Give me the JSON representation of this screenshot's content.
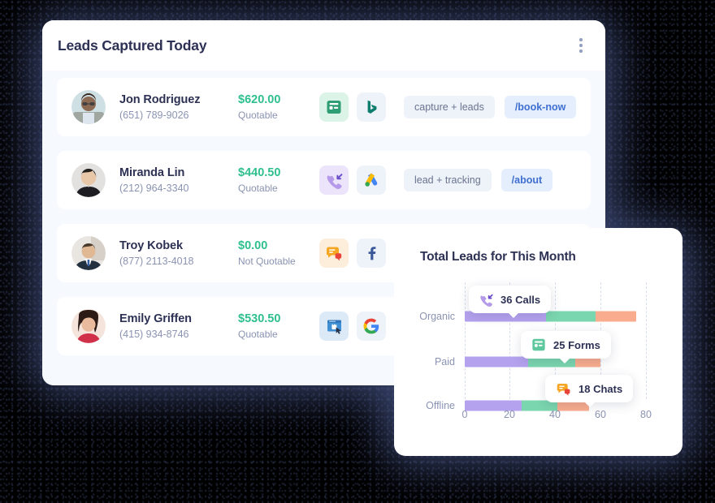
{
  "header": {
    "title": "Leads Captured Today",
    "menu_icon": "kebab-menu-icon"
  },
  "leads": [
    {
      "name": "Jon Rodriguez",
      "phone": "(651) 789-9026",
      "amount": "$620.00",
      "status": "Quotable",
      "channel_icon": "form-icon",
      "source_icon": "bing-icon",
      "tag": "capture + leads",
      "path": "/book-now"
    },
    {
      "name": "Miranda Lin",
      "phone": "(212) 964-3340",
      "amount": "$440.50",
      "status": "Quotable",
      "channel_icon": "inbound-call-icon",
      "source_icon": "google-ads-icon",
      "tag": "lead + tracking",
      "path": "/about"
    },
    {
      "name": "Troy Kobek",
      "phone": "(877) 2113-4018",
      "amount": "$0.00",
      "status": "Not Quotable",
      "channel_icon": "chat-icon",
      "source_icon": "facebook-icon",
      "tag": "",
      "path": ""
    },
    {
      "name": "Emily Griffen",
      "phone": "(415) 934-8746",
      "amount": "$530.50",
      "status": "Quotable",
      "channel_icon": "web-click-icon",
      "source_icon": "google-icon",
      "tag": "",
      "path": ""
    }
  ],
  "chart_panel": {
    "title": "Total Leads for This Month"
  },
  "chart_data": {
    "type": "bar",
    "orientation": "horizontal",
    "stacked": true,
    "title": "Total Leads for This Month",
    "xlabel": "",
    "ylabel": "",
    "xlim": [
      0,
      80
    ],
    "xticks": [
      0,
      20,
      40,
      60,
      80
    ],
    "grid": true,
    "legend": "none",
    "categories": [
      "Organic",
      "Paid",
      "Offline"
    ],
    "series": [
      {
        "name": "Calls",
        "color": "#b5a2ef",
        "values": [
          36,
          28,
          25
        ]
      },
      {
        "name": "Forms",
        "color": "#7ad6ae",
        "values": [
          22,
          21,
          16
        ]
      },
      {
        "name": "Chats",
        "color": "#f9ad8e",
        "values": [
          18,
          11,
          14
        ]
      }
    ],
    "annotations": [
      {
        "label": "36 Calls",
        "icon": "inbound-call-icon",
        "category": "Organic",
        "series": "Calls",
        "value": 36
      },
      {
        "label": "25 Forms",
        "icon": "form-icon",
        "category": "Paid",
        "series": "Forms",
        "value": 25
      },
      {
        "label": "18 Chats",
        "icon": "chat-icon",
        "category": "Offline",
        "series": "Chats",
        "value": 18
      }
    ]
  },
  "colors": {
    "calls": "#b5a2ef",
    "forms": "#7ad6ae",
    "chats": "#f9ad8e",
    "money": "#2fbf8f",
    "title": "#2d3154",
    "muted": "#8a93b2",
    "background": "#000000",
    "halo": "#39456e"
  }
}
